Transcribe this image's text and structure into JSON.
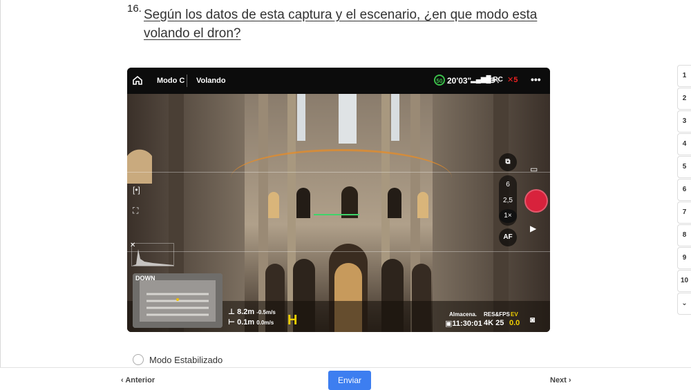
{
  "question": {
    "number": "16.",
    "text": "Según los datos de esta captura y el escenario, ¿en que modo esta volando el dron?"
  },
  "drone_ui": {
    "top_bar": {
      "mode": "Modo C",
      "state": "Volando",
      "battery": "50",
      "flight_time": "20'03\"",
      "signal": "RC",
      "camera_count": "5",
      "more": "•••"
    },
    "zoom_levels": [
      "6",
      "2,5",
      "1×"
    ],
    "af_label": "AF",
    "minimap_label": "DOWN",
    "telemetry": {
      "height": "8.2m",
      "vertical_speed": "-0.5m/s",
      "distance": "0.1m",
      "horizontal_speed": "0.0m/s"
    },
    "home_marker": "H",
    "storage": {
      "label": "Almacena.",
      "value": "11:30:01",
      "res_label": "RES&FPS",
      "res_value": "4K 25",
      "ev_label": "EV",
      "ev_value": "0.0"
    }
  },
  "pager": [
    "1",
    "2",
    "3",
    "4",
    "5",
    "6",
    "7",
    "8",
    "9",
    "10"
  ],
  "answer_option": "Modo Estabilizado",
  "footer": {
    "prev": "Anterior",
    "submit": "Enviar",
    "next": "Next"
  },
  "colors": {
    "accent": "#3d7ef0",
    "record": "#d8223c",
    "battery": "#3bbf4a",
    "ev": "#f0d000"
  }
}
